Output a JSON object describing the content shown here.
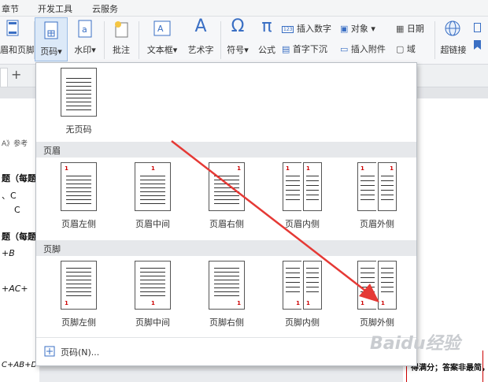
{
  "menubar": {
    "items": [
      "章节",
      "开发工具",
      "云服务"
    ]
  },
  "ribbon": {
    "header_footer": "眉和页脚",
    "page_number": "页码",
    "watermark": "水印",
    "annotation": "批注",
    "textbox": "文本框",
    "art_text": "艺术字",
    "symbol": "符号",
    "formula": "公式",
    "insert_number": "插入数字",
    "object": "对象",
    "date": "日期",
    "drop_cap": "首字下沉",
    "insert_attachment": "插入附件",
    "field": "域",
    "hyperlink": "超链接",
    "page_number_icon_text": "123"
  },
  "tabbar": {
    "add": "+"
  },
  "document": {
    "ref_text": "A》参考",
    "lines": [
      "题（每题",
      "、C",
      "C",
      "题（每题",
      "+B",
      "+AC+",
      "C+AB+D"
    ],
    "right_text": "得满分；答案非最简，过程"
  },
  "dropdown": {
    "none": {
      "label": "无页码"
    },
    "header_section": "页眉",
    "header_options": [
      "页眉左侧",
      "页眉中间",
      "页眉右侧",
      "页眉内侧",
      "页眉外侧"
    ],
    "footer_section": "页脚",
    "footer_options": [
      "页脚左侧",
      "页脚中间",
      "页脚右侧",
      "页脚内侧",
      "页脚外侧"
    ],
    "thumb_number": "1",
    "more": "页码(N)..."
  },
  "watermark_text": "Baidu经验",
  "colors": {
    "accent": "#2f6fcf",
    "arrow": "#e53935",
    "page_num_red": "#cc0000"
  }
}
